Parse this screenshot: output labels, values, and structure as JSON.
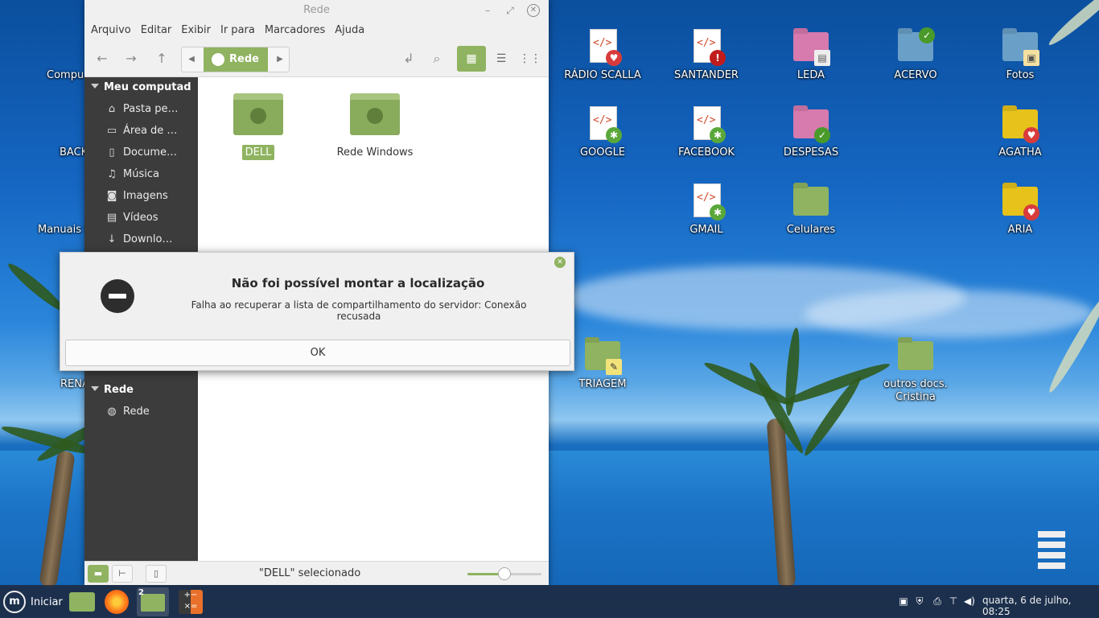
{
  "window": {
    "title": "Rede",
    "menu": [
      "Arquivo",
      "Editar",
      "Exibir",
      "Ir para",
      "Marcadores",
      "Ajuda"
    ],
    "path_crumb": "Rede",
    "sidebar": {
      "section_computer": "Meu computad",
      "items": [
        {
          "label": "Pasta pe…",
          "icon": "home-icon"
        },
        {
          "label": "Área de …",
          "icon": "desktop-icon"
        },
        {
          "label": "Docume…",
          "icon": "document-icon"
        },
        {
          "label": "Música",
          "icon": "music-icon"
        },
        {
          "label": "Imagens",
          "icon": "camera-icon"
        },
        {
          "label": "Vídeos",
          "icon": "film-icon"
        },
        {
          "label": "Downlo…",
          "icon": "download-icon"
        }
      ],
      "section_network": "Rede",
      "network_items": [
        {
          "label": "Rede",
          "icon": "globe-icon"
        }
      ]
    },
    "files": [
      {
        "name": "DELL",
        "selected": true
      },
      {
        "name": "Rede Windows",
        "selected": false
      }
    ],
    "status": "\"DELL\" selecionado",
    "zoom_level": 0.5
  },
  "dialog": {
    "title": "Não foi possível montar a localização",
    "message": "Falha ao recuperar a lista de compartilhamento do servidor: Conexão recusada",
    "ok_label": "OK"
  },
  "desktop_icons": [
    {
      "label": "Compu"
    },
    {
      "label": "BACK"
    },
    {
      "label": "Manuais t"
    },
    {
      "label": "RENA"
    },
    {
      "label": "RÁDIO SCALLA"
    },
    {
      "label": "SANTANDER"
    },
    {
      "label": "LEDA"
    },
    {
      "label": "ACERVO"
    },
    {
      "label": "Fotos"
    },
    {
      "label": "GOOGLE"
    },
    {
      "label": "FACEBOOK"
    },
    {
      "label": "DESPESAS"
    },
    {
      "label": "AGATHA"
    },
    {
      "label": "GMAIL"
    },
    {
      "label": "Celulares"
    },
    {
      "label": "ARIA"
    },
    {
      "label": "TRIAGEM"
    },
    {
      "label": "outros docs. Cristina"
    }
  ],
  "taskbar": {
    "start_label": "Iniciar",
    "badge_count": "2",
    "clock": "quarta,  6 de julho, 08:25"
  },
  "colors": {
    "accent": "#8fb360",
    "sidebar": "#3c3c3c"
  }
}
